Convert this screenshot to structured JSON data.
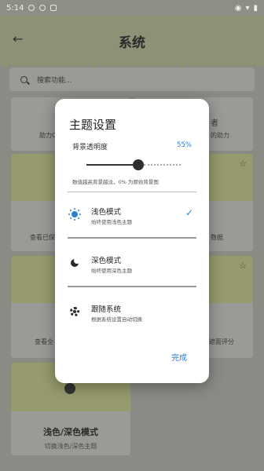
{
  "status_bar": {
    "time": "5:14"
  },
  "app_bar": {
    "title": "系统"
  },
  "search": {
    "placeholder": "搜索功能..."
  },
  "background_cards": {
    "snippets": [
      "助力Chi",
      "者",
      "的助力",
      "查看已保",
      "数据",
      "查看全",
      "遮面评分"
    ],
    "bottom_card": {
      "label": "浅色/深色模式",
      "sub": "切换浅色/深色主题"
    }
  },
  "dialog": {
    "title": "主题设置",
    "opacity_label": "背景透明度",
    "opacity_value_text": "55%",
    "opacity_value": 55,
    "hint": "数值越高背景越淡，0% 为原始背景图",
    "options": [
      {
        "name": "浅色模式",
        "desc": "始终使用浅色主题",
        "icon": "sun-icon",
        "selected": true
      },
      {
        "name": "深色模式",
        "desc": "始终使用深色主题",
        "icon": "moon-icon",
        "selected": false
      },
      {
        "name": "跟随系统",
        "desc": "根据系统设置自动切换",
        "icon": "gear-icon",
        "selected": false
      }
    ],
    "check_glyph": "✓",
    "done_label": "完成"
  },
  "colors": {
    "accent": "#2b7fd6",
    "card_top": "#969a6c",
    "app_bar": "#8e9176"
  }
}
